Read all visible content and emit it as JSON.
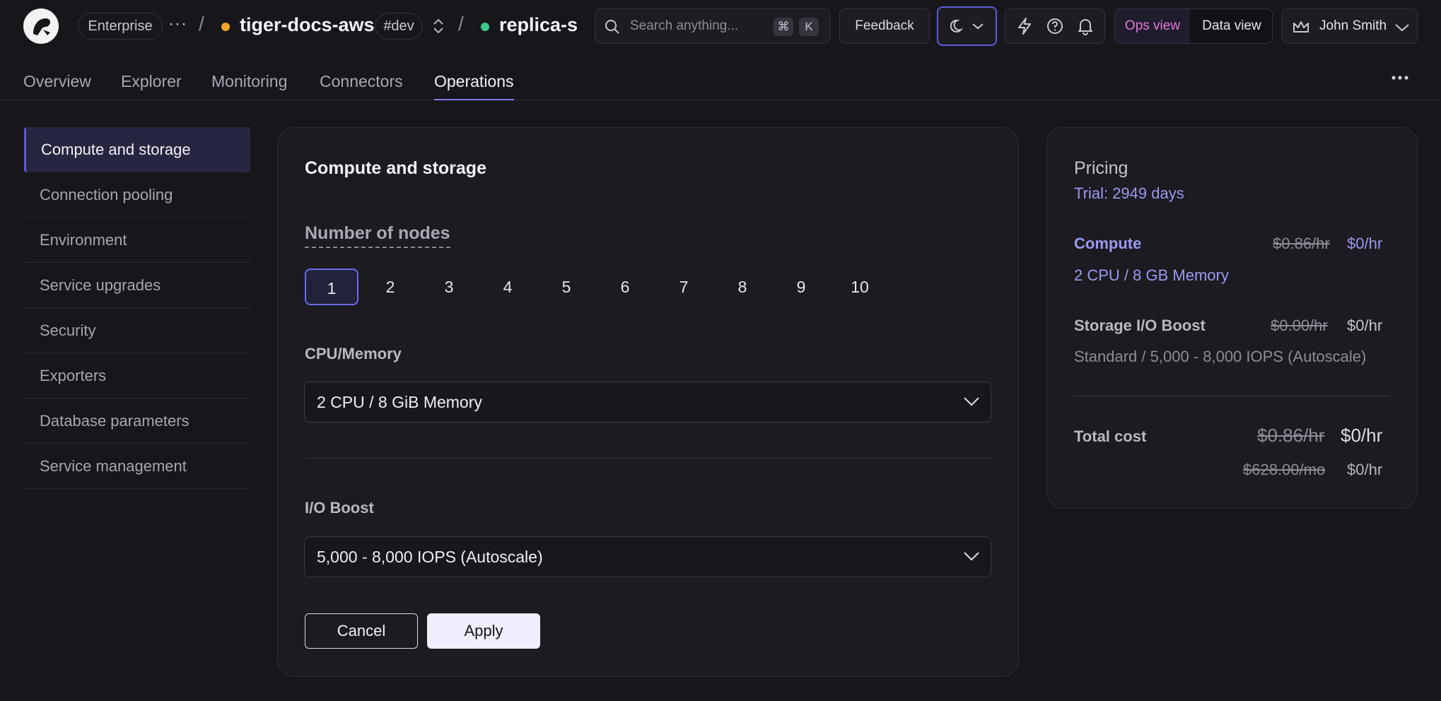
{
  "topbar": {
    "org_label": "Enterprise",
    "more_label": "···",
    "sep1": "/",
    "project_name": "tiger-docs-aws",
    "env_tag": "#dev",
    "sep2": "/",
    "service_name": "replica-s",
    "search_placeholder": "Search anything...",
    "shortcut_cmd": "⌘",
    "shortcut_key": "K",
    "feedback_label": "Feedback",
    "ops_view_label": "Ops view",
    "data_view_label": "Data view",
    "user_name": "John Smith",
    "colors": {
      "project_dot": "#f0a52a",
      "service_dot": "#3ec98c",
      "accent": "#5c5cd8",
      "ops_view": "#e07ad8"
    }
  },
  "nav": {
    "tabs": [
      "Overview",
      "Explorer",
      "Monitoring",
      "Connectors",
      "Operations"
    ],
    "active_tab": "Operations"
  },
  "sidebar": {
    "items": [
      "Compute and storage",
      "Connection pooling",
      "Environment",
      "Service upgrades",
      "Security",
      "Exporters",
      "Database parameters",
      "Service management"
    ],
    "active": "Compute and storage"
  },
  "main": {
    "title": "Compute and storage",
    "nodes_label": "Number of nodes",
    "nodes": [
      "1",
      "2",
      "3",
      "4",
      "5",
      "6",
      "7",
      "8",
      "9",
      "10"
    ],
    "selected_node": "1",
    "cpu_label": "CPU/Memory",
    "cpu_value": "2 CPU / 8 GiB Memory",
    "io_label": "I/O Boost",
    "io_value": "5,000 - 8,000 IOPS (Autoscale)",
    "cancel_label": "Cancel",
    "apply_label": "Apply"
  },
  "pricing": {
    "title": "Pricing",
    "trial": "Trial: 2949 days",
    "compute_label": "Compute",
    "compute_old": "$0.86/hr",
    "compute_new": "$0/hr",
    "compute_detail": "2 CPU / 8 GB Memory",
    "storage_label": "Storage I/O Boost",
    "storage_old": "$0.00/hr",
    "storage_new": "$0/hr",
    "storage_detail": "Standard / 5,000 - 8,000 IOPS (Autoscale)",
    "total_label": "Total cost",
    "total_old": "$0.86/hr",
    "total_new": "$0/hr",
    "monthly_old": "$628.00/mo",
    "monthly_new": "$0/hr"
  }
}
